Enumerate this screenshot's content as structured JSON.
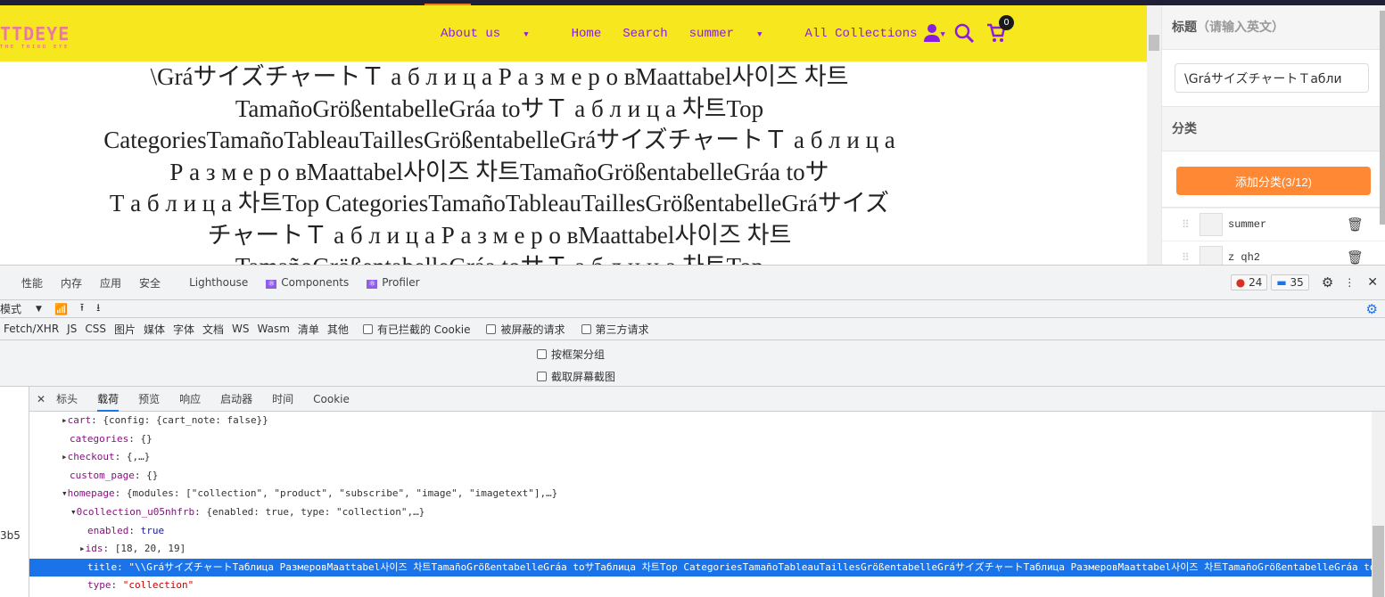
{
  "site": {
    "logo": "TTDEYE",
    "logo_tagline": "THE THIRD EYE",
    "nav": [
      "About us",
      "Home",
      "Search",
      "summer",
      "All Collections"
    ],
    "cart_count": "0",
    "heading_lines": [
      "\\GráサイズチャートＴ а б л и ц а  Р а з м е р о вMaattabel사이즈 차트",
      "TamañoGrößentabelleGráa toサＴ а б л и ц а  차트Top",
      "CategoriesTamañoTableauTaillesGrößentabelleGráサイズチャートＴ а б л и ц а",
      "Р а з м е р о вMaattabel사이즈 차트TamañoGrößentabelleGráa toサ",
      "Т а б л и ц а  차트Top CategoriesTamañoTableauTaillesGrößentabelleGráサイズ",
      "チャートＴ а б л и ц а  Р а з м е р о вMaattabel사이즈 차트",
      "TamañoGrößentabelleGráa toサＴ а б л и ц а 차트Top"
    ]
  },
  "panel": {
    "title_label": "标题",
    "title_hint": "（请输入英文）",
    "title_value": "\\GráサイズチャートＴабли",
    "category_label": "分类",
    "add_button": "添加分类(3/12)",
    "categories": [
      "summer",
      "z qh2"
    ]
  },
  "devtools": {
    "tabs": [
      "性能",
      "内存",
      "应用",
      "安全",
      "Lighthouse",
      "Components",
      "Profiler"
    ],
    "errors": "24",
    "messages": "35",
    "mode": "模式",
    "filters": [
      "Fetch/XHR",
      "JS",
      "CSS",
      "图片",
      "媒体",
      "字体",
      "文档",
      "WS",
      "Wasm",
      "清单",
      "其他"
    ],
    "checkboxes": [
      "有已拦截的 Cookie",
      "被屏蔽的请求",
      "第三方请求"
    ],
    "options": [
      "按框架分组",
      "截取屏幕截图"
    ],
    "detail_tabs": [
      "标头",
      "载荷",
      "预览",
      "响应",
      "启动器",
      "时间",
      "Cookie"
    ],
    "left_fragment": "3b5",
    "tree": [
      {
        "key": "cart",
        "val": "{config: {cart_note: false}}"
      },
      {
        "key": "categories",
        "val": "{}"
      },
      {
        "key": "checkout",
        "val": "{,…}"
      },
      {
        "key": "custom_page",
        "val": "{}"
      },
      {
        "key": "homepage",
        "val": "{modules: [\"collection\", \"product\", \"subscribe\", \"image\", \"imagetext\"],…}"
      },
      {
        "key": "0collection_u05nhfrb",
        "val": "{enabled: true, type: \"collection\",…}"
      },
      {
        "key": "enabled",
        "val": "true"
      },
      {
        "key": "ids",
        "val": "[18, 20, 19]"
      },
      {
        "key": "title",
        "val": "\"\\\\GráサイズチャートТаблица РазмеровMaattabel사이즈 차트TamañoGrößentabelleGráa toサТаблица 차트Top CategoriesTamañoTableauTaillesGrößentabelleGráサイズチャートТаблица РазмеровMaattabel사이즈 차트TamañoGrößentabelleGráa toサ"
      },
      {
        "key": "type",
        "val": "\"collection\""
      }
    ]
  }
}
